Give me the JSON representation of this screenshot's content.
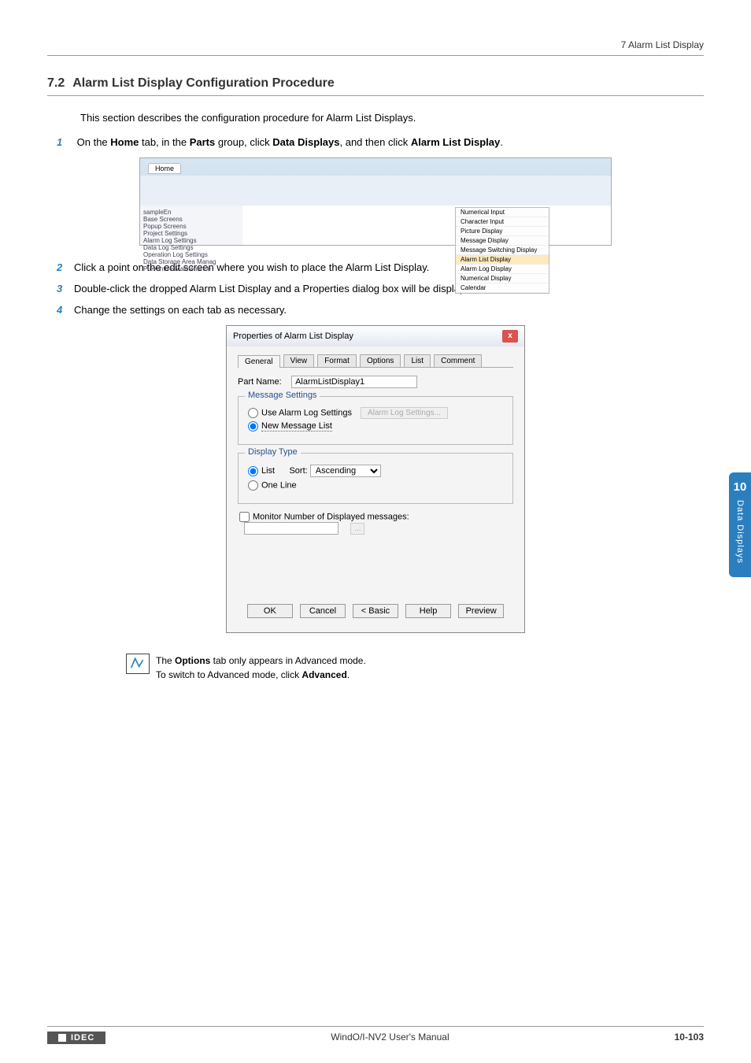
{
  "header": {
    "right": "7 Alarm List Display"
  },
  "section": {
    "num": "7.2",
    "title": "Alarm List Display Configuration Procedure"
  },
  "intro": "This section describes the configuration procedure for Alarm List Displays.",
  "steps": {
    "s1": {
      "num": "1",
      "pre": "On the ",
      "b1": "Home",
      "mid1": " tab, in the ",
      "b2": "Parts",
      "mid2": " group, click ",
      "b3": "Data Displays",
      "mid3": ", and then click ",
      "b4": "Alarm List Display",
      "post": "."
    },
    "s2": {
      "num": "2",
      "text": "Click a point on the edit screen where you wish to place the Alarm List Display."
    },
    "s3": {
      "num": "3",
      "text": "Double-click the dropped Alarm List Display and a Properties dialog box will be displayed."
    },
    "s4": {
      "num": "4",
      "text": "Change the settings on each tab as necessary."
    }
  },
  "ui": {
    "hometab": "Home",
    "menu": [
      "Numerical Input",
      "Character Input",
      "Picture Display",
      "Message Display",
      "Message Switching Display",
      "Alarm List Display",
      "Alarm Log Display",
      "Numerical Display",
      "Calendar"
    ],
    "sidebar": "sampleEn\n  Base Screens\n  Popup Screens\n  Project Settings\n  Alarm Log Settings\n  Data Log Settings\n  Operation Log Settings\n  Data Storage Area Manag\n  Preventive Maintenance"
  },
  "dialog": {
    "title": "Properties of Alarm List Display",
    "tabs": [
      "General",
      "View",
      "Format",
      "Options",
      "List",
      "Comment"
    ],
    "partNameLabel": "Part Name:",
    "partNameValue": "AlarmListDisplay1",
    "groups": {
      "msg": {
        "label": "Message Settings",
        "opt1": "Use Alarm Log Settings",
        "btn": "Alarm Log Settings...",
        "opt2": "New Message List"
      },
      "disp": {
        "label": "Display Type",
        "opt1": "List",
        "sortLabel": "Sort:",
        "sortValue": "Ascending",
        "opt2": "One Line"
      }
    },
    "monitor": "Monitor Number of Displayed messages:",
    "buttons": {
      "ok": "OK",
      "cancel": "Cancel",
      "basic": "< Basic",
      "help": "Help",
      "preview": "Preview"
    }
  },
  "note": {
    "l1a": "The ",
    "l1b": "Options",
    "l1c": " tab only appears in Advanced mode.",
    "l2a": "To switch to Advanced mode, click ",
    "l2b": "Advanced",
    "l2c": "."
  },
  "sideTab": {
    "num": "10",
    "label": "Data Displays"
  },
  "footer": {
    "brand": "IDEC",
    "center": "WindO/I-NV2 User's Manual",
    "right": "10-103"
  }
}
